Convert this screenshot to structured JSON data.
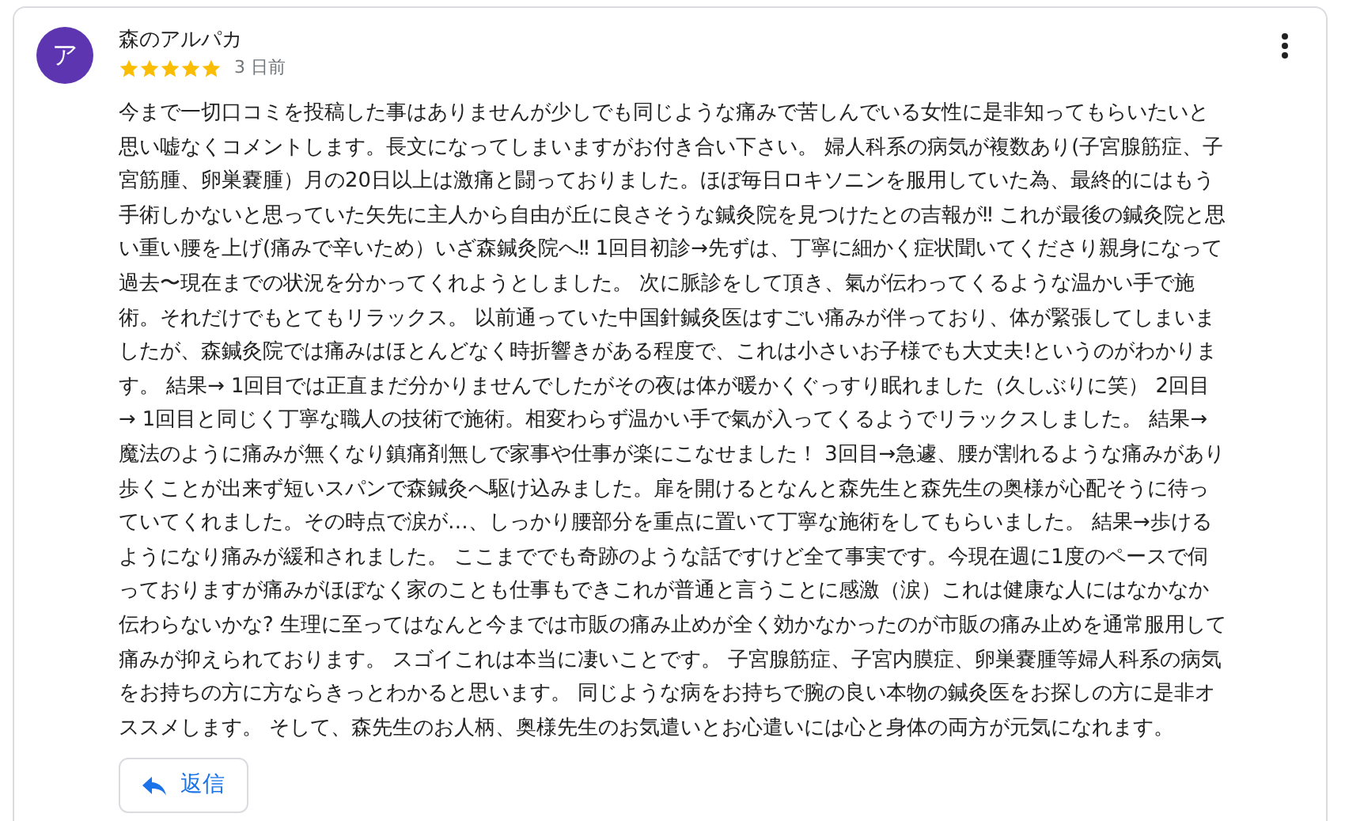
{
  "review": {
    "avatar_letter": "ア",
    "author": "森のアルパカ",
    "stars": 5,
    "time": "3 日前",
    "text": "今まで一切口コミを投稿した事はありませんが少しでも同じような痛みで苦しんでいる女性に是非知ってもらいたいと思い嘘なくコメントします。長文になってしまいますがお付き合い下さい。 婦人科系の病気が複数あり(子宮腺筋症、子宮筋腫、卵巣嚢腫）月の20日以上は激痛と闘っておりました。ほぼ毎日ロキソニンを服用していた為、最終的にはもう手術しかないと思っていた矢先に主人から自由が丘に良さそうな鍼灸院を見つけたとの吉報が‼ これが最後の鍼灸院と思い重い腰を上げ(痛みで辛いため）いざ森鍼灸院へ‼ 1回目初診→先ずは、丁寧に細かく症状聞いてくださり親身になって過去〜現在までの状況を分かってくれようとしました。 次に脈診をして頂き、氣が伝わってくるような温かい手で施術。それだけでもとてもリラックス。 以前通っていた中国針鍼灸医はすごい痛みが伴っており、体が緊張してしまいましたが、森鍼灸院では痛みはほとんどなく時折響きがある程度で、これは小さいお子様でも大丈夫!というのがわかります。 結果→ 1回目では正直まだ分かりませんでしたがその夜は体が暖かくぐっすり眠れました（久しぶりに笑） 2回目→ 1回目と同じく丁寧な職人の技術で施術。相変わらず温かい手で氣が入ってくるようでリラックスしました。 結果→魔法のように痛みが無くなり鎮痛剤無しで家事や仕事が楽にこなせました！ 3回目→急遽、腰が割れるような痛みがあり歩くことが出来ず短いスパンで森鍼灸へ駆け込みました。扉を開けるとなんと森先生と森先生の奥様が心配そうに待っていてくれました。その時点で涙が…、しっかり腰部分を重点に置いて丁寧な施術をしてもらいました。 結果→歩けるようになり痛みが緩和されました。 ここまででも奇跡のような話ですけど全て事実です。今現在週に1度のペースで伺っておりますが痛みがほぼなく家のことも仕事もできこれが普通と言うことに感激（涙）これは健康な人にはなかなか伝わらないかな? 生理に至ってはなんと今までは市販の痛み止めが全く効かなかったのが市販の痛み止めを通常服用して痛みが抑えられております。 スゴイこれは本当に凄いことです。 子宮腺筋症、子宮内膜症、卵巣嚢腫等婦人科系の病気をお持ちの方に方ならきっとわかると思います。 同じような病をお持ちで腕の良い本物の鍼灸医をお探しの方に是非オススメします。 そして、森先生のお人柄、奥様先生のお気遣いとお心遣いには心と身体の両方が元気になれます。"
  },
  "reply_button": {
    "label": "返信"
  }
}
